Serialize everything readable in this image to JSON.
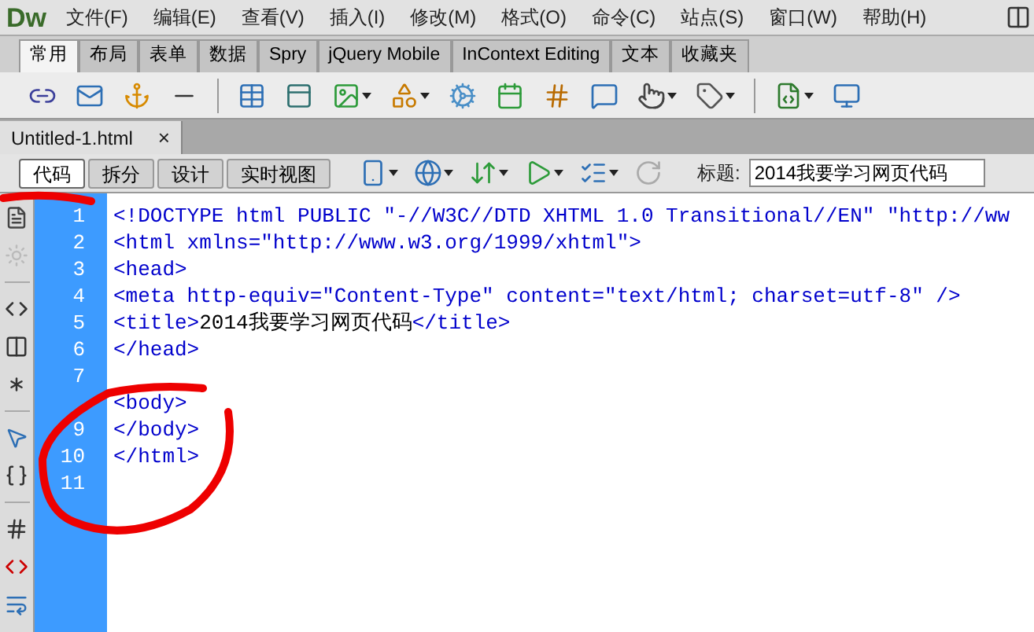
{
  "app": {
    "logo": "Dw"
  },
  "menu": [
    "文件(F)",
    "编辑(E)",
    "查看(V)",
    "插入(I)",
    "修改(M)",
    "格式(O)",
    "命令(C)",
    "站点(S)",
    "窗口(W)",
    "帮助(H)"
  ],
  "insert_tabs": [
    {
      "label": "常用",
      "selected": true
    },
    {
      "label": "布局",
      "selected": false
    },
    {
      "label": "表单",
      "selected": false
    },
    {
      "label": "数据",
      "selected": false
    },
    {
      "label": "Spry",
      "selected": false
    },
    {
      "label": "jQuery Mobile",
      "selected": false
    },
    {
      "label": "InContext Editing",
      "selected": false
    },
    {
      "label": "文本",
      "selected": false
    },
    {
      "label": "收藏夹",
      "selected": false
    }
  ],
  "document_tab": {
    "label": "Untitled-1.html",
    "close": "×"
  },
  "view_buttons": [
    {
      "label": "代码",
      "selected": true
    },
    {
      "label": "拆分",
      "selected": false
    },
    {
      "label": "设计",
      "selected": false
    },
    {
      "label": "实时视图",
      "selected": false
    }
  ],
  "title_field": {
    "label": "标题:",
    "value": "2014我要学习网页代码"
  },
  "code_lines": [
    {
      "number": "1",
      "segments": [
        {
          "kind": "tag",
          "text": "<!DOCTYPE html PUBLIC \"-//W3C//DTD XHTML 1.0 Transitional//EN\" \"http://ww"
        }
      ]
    },
    {
      "number": "2",
      "segments": [
        {
          "kind": "tag",
          "text": "<html xmlns=\"http://www.w3.org/1999/xhtml\">"
        }
      ]
    },
    {
      "number": "3",
      "segments": [
        {
          "kind": "tag",
          "text": "<head>"
        }
      ]
    },
    {
      "number": "4",
      "segments": [
        {
          "kind": "tag",
          "text": "<meta http-equiv=\"Content-Type\" content=\"text/html; charset=utf-8\" />"
        }
      ]
    },
    {
      "number": "5",
      "segments": [
        {
          "kind": "tag",
          "text": "<title>"
        },
        {
          "kind": "text",
          "text": "2014我要学习网页代码"
        },
        {
          "kind": "tag",
          "text": "</title>"
        }
      ]
    },
    {
      "number": "6",
      "segments": [
        {
          "kind": "tag",
          "text": "</head>"
        }
      ]
    },
    {
      "number": "7"
    },
    {
      "segments": [
        {
          "kind": "tag",
          "text": "<body>"
        }
      ]
    },
    {
      "number": "9",
      "segments": [
        {
          "kind": "tag",
          "text": "</body>"
        }
      ]
    },
    {
      "number": "10",
      "segments": [
        {
          "kind": "tag",
          "text": "</html>"
        }
      ]
    },
    {
      "number": "11"
    }
  ]
}
